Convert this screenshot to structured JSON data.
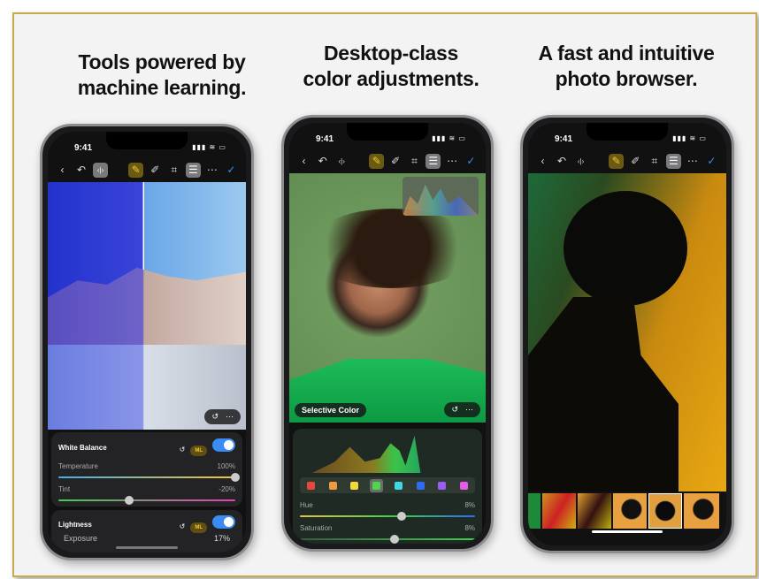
{
  "headlines": [
    {
      "line1": "Tools powered by",
      "line2": "machine learning."
    },
    {
      "line1": "Desktop-class",
      "line2": "color adjustments."
    },
    {
      "line1": "A fast and intuitive",
      "line2": "photo browser."
    }
  ],
  "status": {
    "time": "9:41",
    "signal": "▮▮▮ ≋ ▭"
  },
  "icons": {
    "back": "‹",
    "undo": "↶",
    "compare": "‹|›",
    "ml": "✎",
    "heal": "✐",
    "crop": "⌗",
    "adjust": "☰",
    "more": "⋯",
    "done": "✓",
    "reset": "↺"
  },
  "phone1": {
    "white_balance": {
      "title": "White Balance",
      "ml": "ML",
      "enabled": true,
      "temperature": {
        "label": "Temperature",
        "value": "100%",
        "level": 1.0
      },
      "tint": {
        "label": "Tint",
        "value": "-20%",
        "level": 0.4
      }
    },
    "lightness": {
      "title": "Lightness",
      "ml": "ML",
      "enabled": true,
      "exposure": {
        "label": "Exposure",
        "value": "17%"
      }
    }
  },
  "phone2": {
    "tool_name": "Selective Color",
    "swatches": [
      "#e8473b",
      "#f39a3c",
      "#f5d83a",
      "#4cd64a",
      "#3fd9e6",
      "#2f6cf2",
      "#9a5cf5",
      "#e45ce8"
    ],
    "selected_swatch": 3,
    "hue": {
      "label": "Hue",
      "value": "8%",
      "level": 0.58
    },
    "saturation": {
      "label": "Saturation",
      "value": "8%",
      "level": 0.54
    }
  },
  "colors": {
    "accent": "#3a8cf5",
    "ml": "#f2c530",
    "border": "#c9a94c"
  }
}
